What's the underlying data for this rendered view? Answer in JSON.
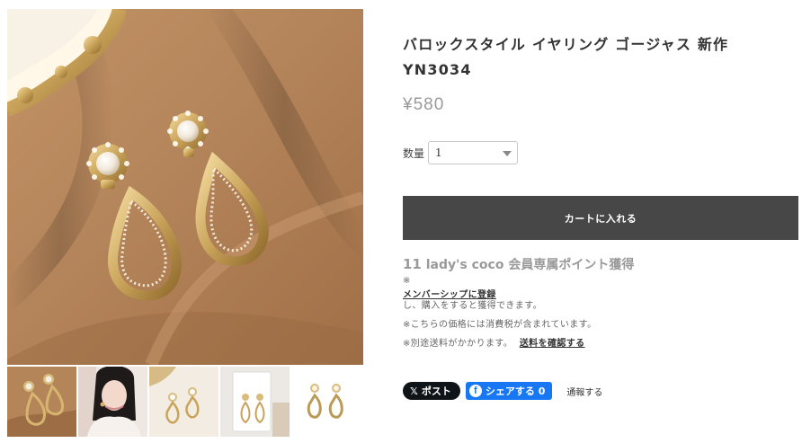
{
  "product": {
    "title": "バロックスタイル イヤリング ゴージャス 新作 YN3034",
    "price": "¥580"
  },
  "quantity": {
    "label": "数量",
    "selected": "1"
  },
  "cart_button_label": "カートに入れる",
  "points": {
    "count": "11",
    "text": "lady's coco 会員専属ポイント獲得"
  },
  "notes": {
    "membership_prefix": "※",
    "membership_link": "メンバーシップに登録",
    "membership_suffix": "し、購入をすると獲得できます。",
    "tax_note": "※こちらの価格には消費税が含まれています。",
    "shipping_prefix": "※別途送料がかかります。",
    "shipping_link": "送料を確認する"
  },
  "share": {
    "x_label": "ポスト",
    "facebook_label": "シェアする 0",
    "report_label": "通報する"
  },
  "gallery": {
    "main_alt": "earrings-on-brown-fabric",
    "thumbnails": [
      "earrings-on-fabric",
      "model-wearing-earrings",
      "earrings-pair",
      "earrings-on-card",
      "earrings-white-background"
    ]
  },
  "colors": {
    "cart_button": "#474747",
    "background_fabric": "#b8865a",
    "x_button": "#0f1419",
    "facebook_button": "#1877f2"
  }
}
